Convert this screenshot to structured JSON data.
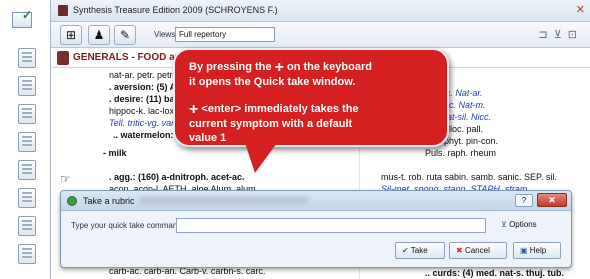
{
  "window": {
    "title": "Synthesis Treasure Edition 2009 (SCHROYENS F.)",
    "close": "✕"
  },
  "toolbar": {
    "views_label": "Views:",
    "views_value": "Full repertory"
  },
  "rubric_path": "GENERALS - FOOD and DRINKS - m",
  "content_lines": [
    {
      "id": "l1",
      "text": "nat-ar. petr. petr-ra. puls. c"
    },
    {
      "id": "l2",
      "text": ". aversion: (5) Ars. Chin."
    },
    {
      "id": "l3",
      "text": ". desire: (11) bar-ox-suc."
    },
    {
      "id": "l4",
      "text": "hippoc-k. lac-loxod-a. petr"
    },
    {
      "id": "l5",
      "text": "Tell. tritic-vg. vanil."
    },
    {
      "id": "l6",
      "text": ".. watermelon: (1) staph"
    },
    {
      "id": "l7",
      "text": "- milk"
    },
    {
      "id": "l8",
      "text": ". agg.: (160) a-dnitroph. acet-ac."
    },
    {
      "id": "l9",
      "text": "acon. acon-l. AETH. aloe Alum. alum"
    },
    {
      "id": "r1",
      "text": "nur-ac. Nat-ar."
    },
    {
      "id": "r2",
      "text": "Nat-lac. Nat-m."
    },
    {
      "id": "r3",
      "text": "it-s. nat-sil. Nicc."
    },
    {
      "id": "r4",
      "text": "j. oscilloc. pall."
    },
    {
      "id": "r5",
      "text": "nys. phyt. pin-con."
    },
    {
      "id": "r6",
      "text": "Puls. raph. rheum"
    },
    {
      "id": "r7",
      "text": "mus-t. rob. ruta sabin. samb. sanic. SEP. sil."
    },
    {
      "id": "r8",
      "text": "Sil-met. spong. stann. STAPH. stram."
    },
    {
      "id": "b1",
      "text": "carb-ac. carb-an. Carb-v. carbn-s. carc."
    },
    {
      "id": "b2",
      "text": ".. curds: (4) med. nat-s. thuj. tub."
    }
  ],
  "callout": {
    "line1a": "By pressing the",
    "plus": "+",
    "line1b": "on the keyboard",
    "line2": "it opens the Quick take window.",
    "line3": "<enter> immediately takes the",
    "line4": "current symptom with a default",
    "line5": "value 1"
  },
  "dialog": {
    "title": "Take a rubric",
    "help_btn": "?",
    "close_btn": "✕",
    "label": "Type your quick take command:",
    "input_value": "",
    "options_label": "Options",
    "take_label": "Take",
    "cancel_label": "Cancel",
    "help_label": "Help"
  }
}
